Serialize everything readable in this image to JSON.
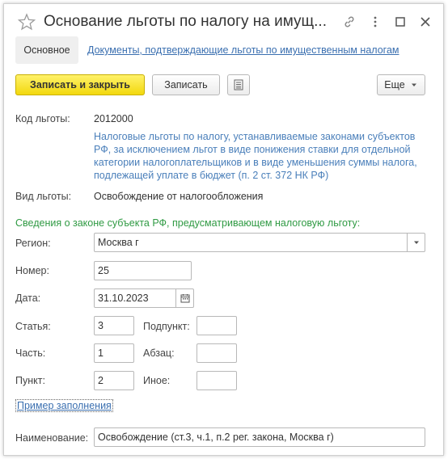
{
  "window": {
    "title": "Основание льготы по налогу на имущ...",
    "icons": [
      "star-icon",
      "link-icon",
      "more-vert-icon",
      "maximize-icon",
      "close-icon"
    ]
  },
  "tabs": {
    "main": "Основное",
    "documents": "Документы, подтверждающие льготы по имущественным налогам"
  },
  "toolbar": {
    "save_close": "Записать и закрыть",
    "save": "Записать",
    "more": "Еще",
    "report_icon": "report-icon"
  },
  "form": {
    "code_label": "Код льготы:",
    "code_value": "2012000",
    "code_description": "Налоговые льготы по налогу, устанавливаемые законами субъектов РФ, за исключением льгот в виде понижения ставки для отдельной категории налогоплательщиков и в виде уменьшения суммы налога, подлежащей уплате в бюджет (п. 2 ст. 372 НК РФ)",
    "type_label": "Вид льготы:",
    "type_value": "Освобождение от налогообложения",
    "section_title": "Сведения о законе субъекта РФ, предусматривающем налоговую льготу:",
    "region_label": "Регион:",
    "region_value": "Москва г",
    "number_label": "Номер:",
    "number_value": "25",
    "date_label": "Дата:",
    "date_value": "31.10.2023",
    "article_label": "Статья:",
    "article_value": "3",
    "subitem_label": "Подпункт:",
    "subitem_value": "",
    "part_label": "Часть:",
    "part_value": "1",
    "paragraph_label": "Абзац:",
    "paragraph_value": "",
    "item_label": "Пункт:",
    "item_value": "2",
    "other_label": "Иное:",
    "other_value": "",
    "sample_link": "Пример заполнения",
    "name_label": "Наименование:",
    "name_value": "Освобождение (ст.3, ч.1, п.2 рег. закона, Москва г)"
  },
  "colors": {
    "primary_button": "#f2d80d",
    "link": "#3a6fb0",
    "description": "#4a7fba",
    "section_header": "#2f9a43"
  }
}
